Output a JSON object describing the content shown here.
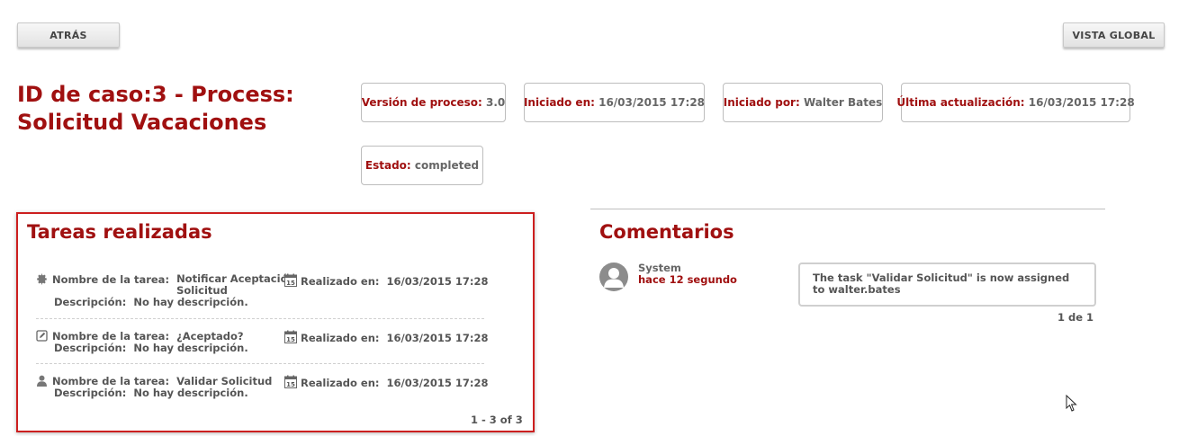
{
  "toolbar": {
    "back_label": "ATRÁS",
    "global_view_label": "VISTA GLOBAL"
  },
  "case": {
    "title_line1": "ID de caso:3 - Process:",
    "title_line2": "Solicitud Vacaciones",
    "info": [
      {
        "key": "Versión de proceso:",
        "value": "3.0"
      },
      {
        "key": "Iniciado en:",
        "value": "16/03/2015 17:28"
      },
      {
        "key": "Iniciado por:",
        "value": "Walter Bates"
      },
      {
        "key": "Última actualización:",
        "value": "16/03/2015 17:28"
      },
      {
        "key": "Estado:",
        "value": "completed"
      }
    ]
  },
  "tasks": {
    "title": "Tareas realizadas",
    "name_label": "Nombre de la tarea:",
    "desc_label": "Descripción:",
    "done_label": "Realizado en:",
    "items": [
      {
        "icon": "gear-icon",
        "name": "Notificar Aceptación Solicitud",
        "description": "No hay descripción.",
        "done_at": "16/03/2015 17:28"
      },
      {
        "icon": "edit-icon",
        "name": "¿Aceptado?",
        "description": "No hay descripción.",
        "done_at": "16/03/2015 17:28"
      },
      {
        "icon": "user-icon",
        "name": "Validar Solicitud",
        "description": "No hay descripción.",
        "done_at": "16/03/2015 17:28"
      }
    ],
    "pager": "1 - 3 of 3"
  },
  "comments": {
    "title": "Comentarios",
    "items": [
      {
        "user": "System",
        "time": "hace 12 segundo",
        "text": "The task \"Validar Solicitud\" is now assigned to walter.bates"
      }
    ],
    "pager": "1 de 1"
  },
  "colors": {
    "accent": "#a01010",
    "panel_border": "#cc1f1f"
  }
}
